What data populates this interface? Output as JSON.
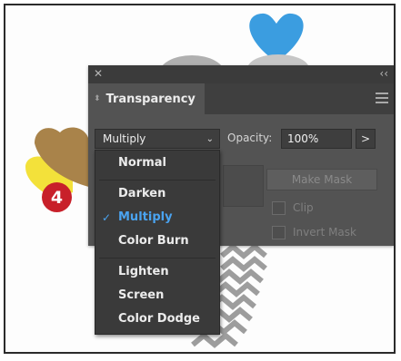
{
  "badge": {
    "number": "4"
  },
  "panel": {
    "title": "Transparency",
    "close_icon": "close-icon",
    "collapse_icon": "collapse-icon",
    "menu_icon": "hamburger-menu-icon",
    "blend_mode": "Multiply",
    "opacity_label": "Opacity:",
    "opacity_value": "100%",
    "opacity_arrow": ">",
    "make_mask_label": "Make Mask",
    "clip_label": "Clip",
    "invert_mask_label": "Invert Mask"
  },
  "blend_menu": {
    "groups": [
      [
        "Normal"
      ],
      [
        "Darken",
        "Multiply",
        "Color Burn"
      ],
      [
        "Lighten",
        "Screen",
        "Color Dodge"
      ]
    ],
    "selected": "Multiply"
  },
  "colors": {
    "panel_bg": "#535353",
    "menu_bg": "#3a3a3a",
    "accent": "#4aa3f0",
    "badge": "#c8202a",
    "heart_blue": "#3b9de0",
    "heart_gold": "#a9834a",
    "heart_yellow": "#f3e13a",
    "heart_gray": "#b0b0b0",
    "chevron_gray": "#9d9d9d"
  }
}
